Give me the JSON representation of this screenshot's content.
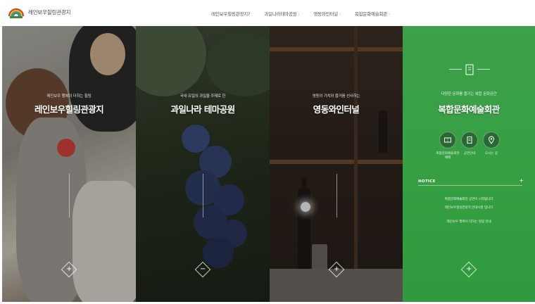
{
  "header": {
    "site_name": "레인보우힐링관광지",
    "nav": [
      {
        "label": "레인보우힐링관광지?"
      },
      {
        "label": "과일나라테마공원",
        "chevron": "›"
      },
      {
        "label": "영동와인터널",
        "chevron": "›"
      },
      {
        "label": "복합문화예술회관",
        "chevron": "›"
      }
    ]
  },
  "panels": [
    {
      "subtitle": "레인보우 행복이 더하는 힐링",
      "title": "레인보우힐링관광지",
      "button": "+"
    },
    {
      "subtitle": "국내 유일의 과일을 주제로 한",
      "title": "과일나라 테마공원",
      "button": "−"
    },
    {
      "subtitle": "영동의 가치와 즐거움 선사하는",
      "title": "영동와인터널",
      "button": "+"
    },
    {
      "subtitle": "다양한 문화를 즐기는 복합 문화공간",
      "title": "복합문화예술회관",
      "button": "+",
      "circles": [
        {
          "icon": "ticket-icon",
          "label": "복합문화예술회관 예매"
        },
        {
          "icon": "document-icon",
          "label": "공연안내"
        },
        {
          "icon": "location-pin-icon",
          "label": "오시는 길"
        }
      ],
      "notice": {
        "title": "NOTICE",
        "more": "+",
        "items": [
          "복합문화예술회관 공연이 시작됩니다",
          "레인보우힐링관광지 안내사항 입니다",
          "레인보우 행복이 더하는 힐링 안내"
        ]
      }
    }
  ],
  "colors": {
    "green": "#36a043",
    "header_bg": "#ffffff"
  }
}
